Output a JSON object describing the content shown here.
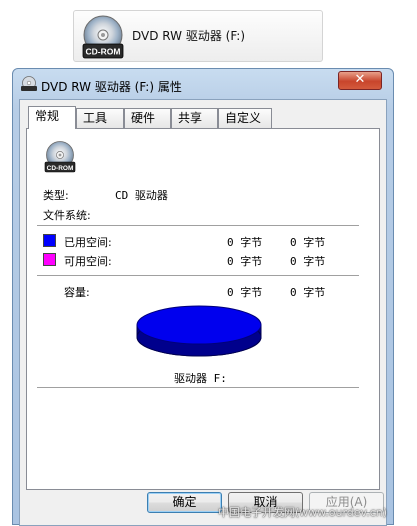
{
  "explorer": {
    "drive_name": "DVD RW 驱动器 (F:)",
    "icon": "cd-rom-drive-icon",
    "icon_text": "CD-ROM"
  },
  "dialog": {
    "title": "DVD RW 驱动器 (F:) 属性",
    "close_label": "✕",
    "tabs": [
      {
        "label": "常规",
        "active": true
      },
      {
        "label": "工具",
        "active": false
      },
      {
        "label": "硬件",
        "active": false
      },
      {
        "label": "共享",
        "active": false
      },
      {
        "label": "自定义",
        "active": false
      }
    ],
    "general": {
      "drive_icon": "cd-rom-drive-icon",
      "icon_text": "CD-ROM",
      "type_label": "类型:",
      "type_value": "CD 驱动器",
      "fs_label": "文件系统:",
      "fs_value": "",
      "used_label": "已用空间:",
      "used_value": "0 字节",
      "used_bytes": "0 字节",
      "used_color": "#0000ff",
      "free_label": "可用空间:",
      "free_value": "0 字节",
      "free_bytes": "0 字节",
      "free_color": "#ff00ff",
      "capacity_label": "容量:",
      "capacity_value": "0 字节",
      "capacity_bytes": "0 字节",
      "pie_color": "#0000ff",
      "drive_label": "驱动器 F:"
    },
    "buttons": {
      "ok": "确定",
      "cancel": "取消",
      "apply": "应用(A)"
    }
  },
  "watermark": "中国电子开发网(www.ourdev.cn)"
}
